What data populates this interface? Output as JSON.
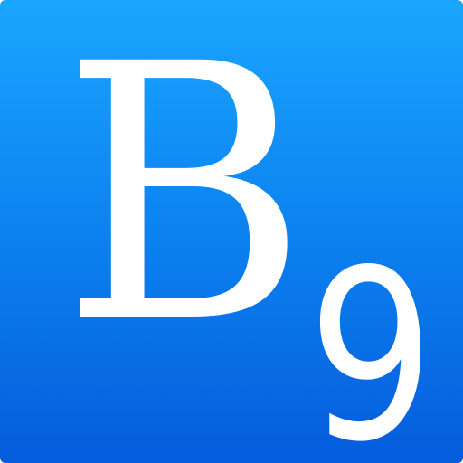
{
  "icon": {
    "letter": "B",
    "subscript": "9",
    "colors": {
      "gradient_top": "#1aa6ff",
      "gradient_bottom": "#055cdc",
      "glyph": "#ffffff"
    }
  }
}
